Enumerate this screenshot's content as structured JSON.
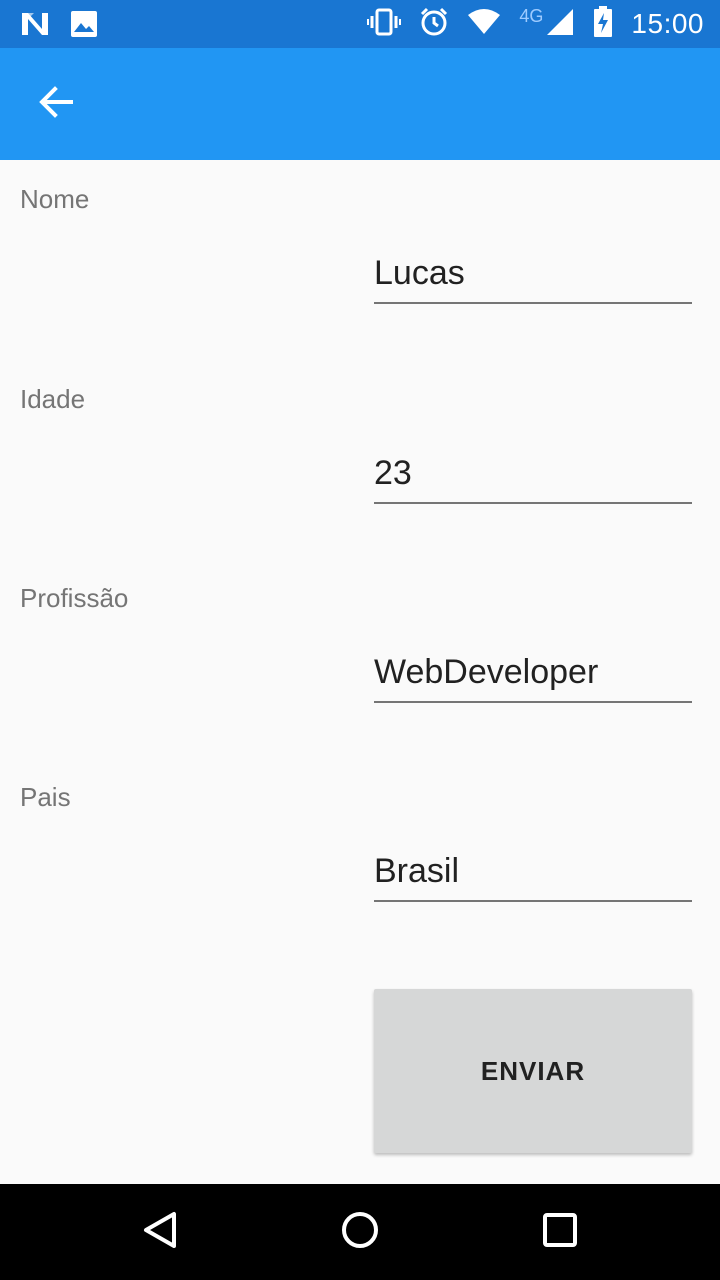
{
  "status_bar": {
    "time": "15:00",
    "network_type": "4G",
    "icons": [
      "n-logo-icon",
      "image-icon",
      "vibrate-icon",
      "alarm-icon",
      "wifi-icon",
      "signal-icon",
      "battery-charging-icon"
    ]
  },
  "app_bar": {
    "back_icon": "arrow-back-icon",
    "color": "#2196f3"
  },
  "form": {
    "fields": [
      {
        "label": "Nome",
        "value": "Lucas"
      },
      {
        "label": "Idade",
        "value": "23"
      },
      {
        "label": "Profissão",
        "value": "WebDeveloper"
      },
      {
        "label": "Pais",
        "value": "Brasil"
      }
    ],
    "submit_label": "ENVIAR"
  },
  "nav_bar": {
    "icons": [
      "back-triangle-icon",
      "home-circle-icon",
      "recents-square-icon"
    ]
  },
  "colors": {
    "status_bar": "#1976d2",
    "app_bar": "#2196f3",
    "background": "#fafafa",
    "button": "#d6d7d7"
  }
}
